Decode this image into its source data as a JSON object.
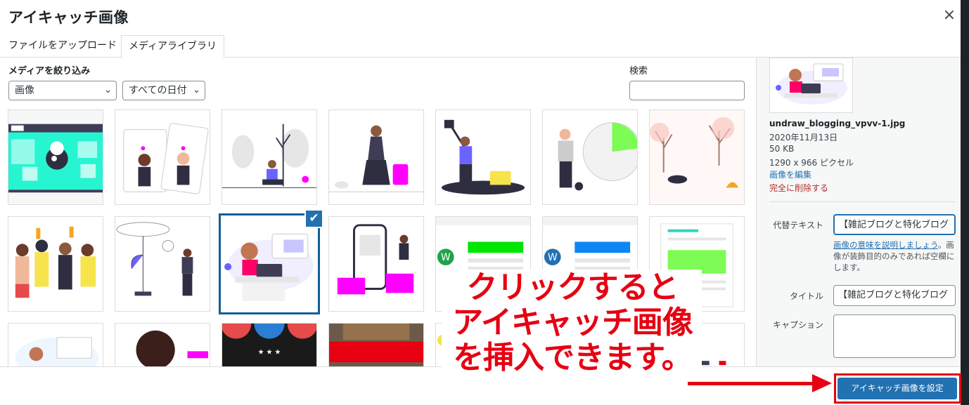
{
  "modal": {
    "title": "アイキャッチ画像",
    "close_symbol": "×"
  },
  "tabs": [
    {
      "label": "ファイルをアップロード"
    },
    {
      "label": "メディアライブラリ"
    }
  ],
  "filters": {
    "label": "メディアを絞り込み",
    "type_select": {
      "value": "画像"
    },
    "date_select": {
      "value": "すべての日付"
    },
    "search_label": "検索",
    "search_value": ""
  },
  "media_items": [
    {
      "row": 1,
      "col": 1,
      "kind": "teal-monster",
      "selected": false
    },
    {
      "row": 1,
      "col": 2,
      "kind": "cards-couple",
      "selected": false
    },
    {
      "row": 1,
      "col": 3,
      "kind": "trees-sitting",
      "selected": false
    },
    {
      "row": 1,
      "col": 4,
      "kind": "travel-suitcase",
      "selected": false
    },
    {
      "row": 1,
      "col": 5,
      "kind": "shovel-treasure",
      "selected": false
    },
    {
      "row": 1,
      "col": 6,
      "kind": "pie-chart-man",
      "selected": false
    },
    {
      "row": 1,
      "col": 7,
      "kind": "park-autumn",
      "selected": false
    },
    {
      "row": 2,
      "col": 1,
      "kind": "team-toast",
      "selected": false
    },
    {
      "row": 2,
      "col": 2,
      "kind": "plant-woman",
      "selected": false
    },
    {
      "row": 2,
      "col": 3,
      "kind": "blogging",
      "selected": true
    },
    {
      "row": 2,
      "col": 4,
      "kind": "phone-mockup",
      "selected": false
    },
    {
      "row": 2,
      "col": 5,
      "kind": "wp-green",
      "selected": false
    },
    {
      "row": 2,
      "col": 6,
      "kind": "wp-blue",
      "selected": false
    },
    {
      "row": 2,
      "col": 7,
      "kind": "doc-green",
      "selected": false
    }
  ],
  "selected_check": "✔",
  "details": {
    "filename": "undraw_blogging_vpvv-1.jpg",
    "date": "2020年11月13日",
    "size": "50 KB",
    "dimensions": "1290 x 966 ピクセル",
    "edit_link": "画像を編集",
    "delete_link": "完全に削除する",
    "alt_label": "代替テキスト",
    "alt_value": "【雑記ブログと特化ブログ",
    "alt_help_link": "画像の意味を説明しましょう",
    "alt_help_text": "。画像が装飾目的のみであれば空欄にします。",
    "title_label": "タイトル",
    "title_value": "【雑記ブログと特化ブログ",
    "caption_label": "キャプション",
    "caption_value": ""
  },
  "annotation": {
    "line1": "クリックすると",
    "line2": "アイキャッチ画像",
    "line3": "を挿入できます。",
    "color": "#e60012"
  },
  "footer": {
    "set_button": "アイキャッチ画像を設定"
  },
  "colors": {
    "accent": "#2271b1",
    "danger": "#b32d2e",
    "annotation_red": "#e60012"
  }
}
